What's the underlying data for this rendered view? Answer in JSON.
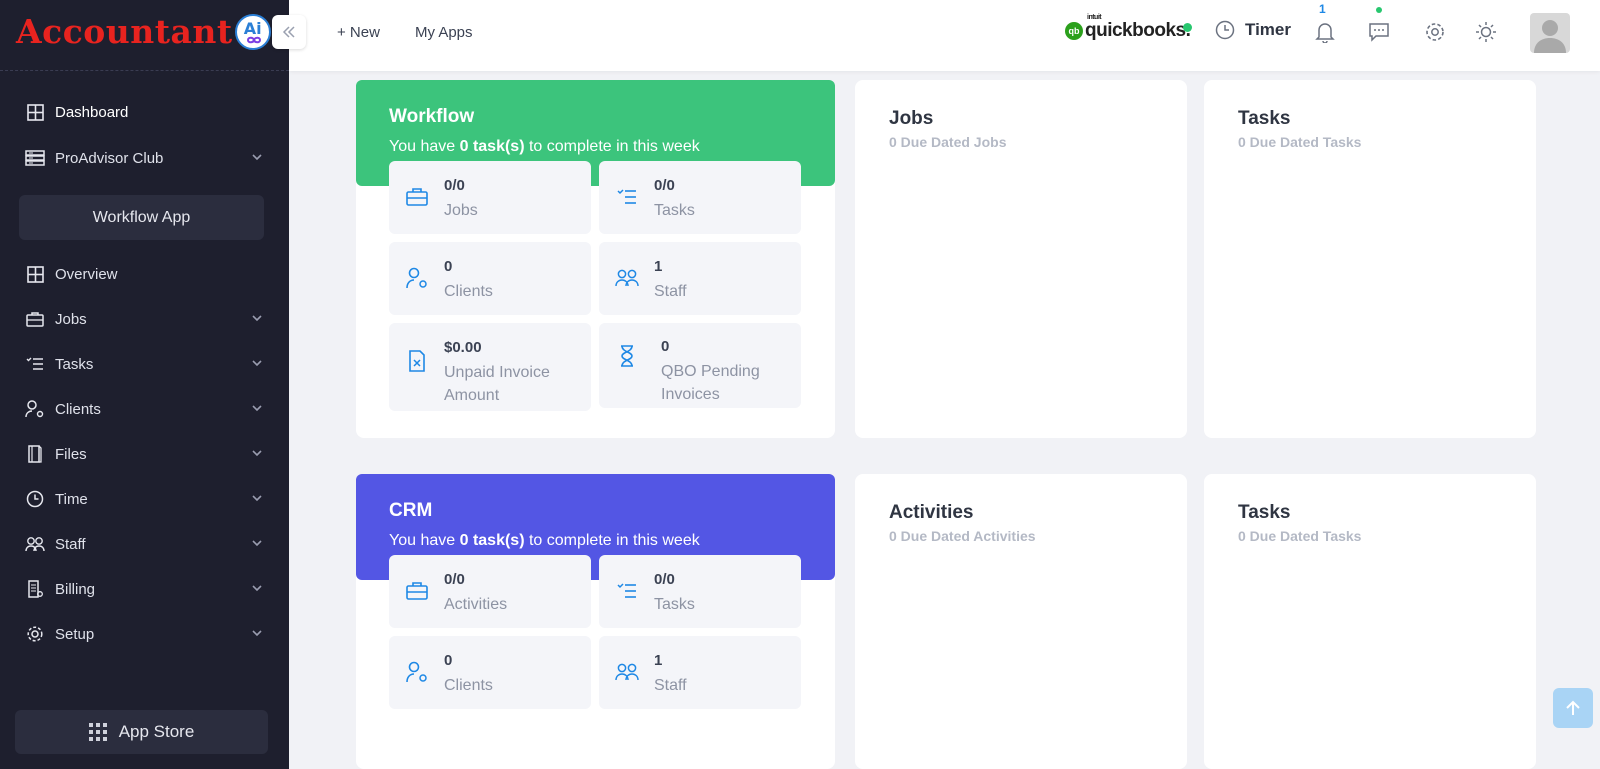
{
  "brand": {
    "logo_text": "Accountant",
    "logo_badge": "Ai"
  },
  "sidebar": {
    "items": [
      {
        "label": "Dashboard",
        "icon": "grid-icon"
      },
      {
        "label": "ProAdvisor Club",
        "icon": "server-icon"
      },
      {
        "label": "Overview",
        "icon": "grid-icon"
      },
      {
        "label": "Jobs",
        "icon": "briefcase-icon"
      },
      {
        "label": "Tasks",
        "icon": "list-check-icon"
      },
      {
        "label": "Clients",
        "icon": "user-gear-icon"
      },
      {
        "label": "Files",
        "icon": "book-icon"
      },
      {
        "label": "Time",
        "icon": "clock-icon"
      },
      {
        "label": "Staff",
        "icon": "users-icon"
      },
      {
        "label": "Billing",
        "icon": "receipt-icon"
      },
      {
        "label": "Setup",
        "icon": "gear-icon"
      }
    ],
    "workflow_app": "Workflow App",
    "app_store": "App Store"
  },
  "topbar": {
    "new_label": "+ New",
    "my_apps_label": "My Apps",
    "quickbooks_intuit": "intuit",
    "quickbooks_label": "quickbooks.",
    "timer_label": "Timer",
    "notification_count": "1"
  },
  "workflow": {
    "title": "Workflow",
    "subtitle_pre": "You have ",
    "subtitle_bold": "0 task(s)",
    "subtitle_post": " to complete in this week",
    "stats": [
      {
        "value": "0/0",
        "label": "Jobs",
        "icon": "briefcase-icon"
      },
      {
        "value": "0/0",
        "label": "Tasks",
        "icon": "list-check-icon"
      },
      {
        "value": "0",
        "label": "Clients",
        "icon": "user-gear-icon"
      },
      {
        "value": "1",
        "label": "Staff",
        "icon": "users-icon"
      },
      {
        "value": "$0.00",
        "label_line1": "Unpaid Invoice",
        "label_line2": "Amount",
        "icon": "invoice-icon"
      },
      {
        "value": "0",
        "label_line1": "QBO Pending",
        "label_line2": "Invoices",
        "icon": "hourglass-icon"
      }
    ]
  },
  "jobs_panel": {
    "title": "Jobs",
    "subtitle": "0 Due Dated Jobs"
  },
  "tasks_panel_1": {
    "title": "Tasks",
    "subtitle": "0 Due Dated Tasks"
  },
  "crm": {
    "title": "CRM",
    "subtitle_pre": "You have ",
    "subtitle_bold": "0 task(s)",
    "subtitle_post": " to complete in this week",
    "stats": [
      {
        "value": "0/0",
        "label": "Activities",
        "icon": "briefcase-icon"
      },
      {
        "value": "0/0",
        "label": "Tasks",
        "icon": "list-check-icon"
      },
      {
        "value": "0",
        "label": "Clients",
        "icon": "user-gear-icon"
      },
      {
        "value": "1",
        "label": "Staff",
        "icon": "users-icon"
      }
    ]
  },
  "activities_panel": {
    "title": "Activities",
    "subtitle": "0 Due Dated Activities"
  },
  "tasks_panel_2": {
    "title": "Tasks",
    "subtitle": "0 Due Dated Tasks"
  },
  "colors": {
    "workflow_green": "#3cc47c",
    "crm_indigo": "#5356e4",
    "sidebar_bg": "#1e1f2e",
    "accent_blue": "#1e88e5"
  }
}
